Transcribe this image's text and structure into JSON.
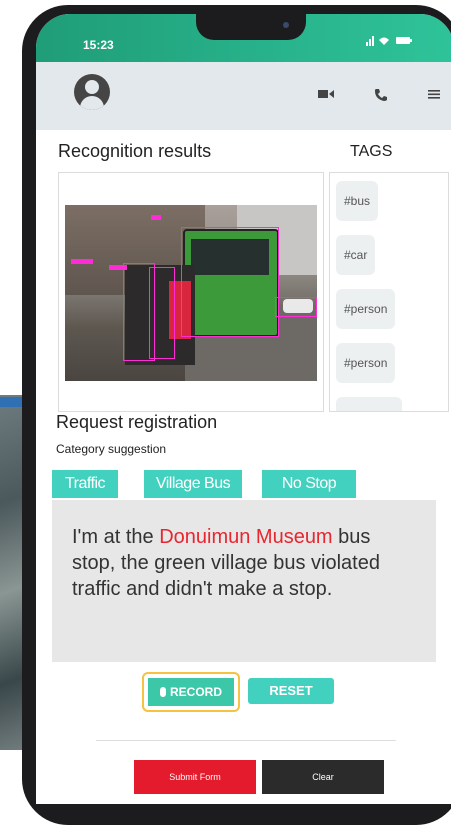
{
  "status_bar": {
    "time": "15:23",
    "icons": "signal, wifi, battery"
  },
  "app_bar": {
    "avatar": "user-avatar",
    "icons": [
      "video-icon",
      "phone-icon",
      "menu-icon"
    ]
  },
  "recognition": {
    "title": "Recognition results",
    "tags_title": "TAGS",
    "tags": [
      "#bus",
      "#car",
      "#person",
      "#person"
    ]
  },
  "request": {
    "title": "Request registration",
    "category_label": "Category suggestion",
    "categories": [
      "Traffic",
      "Village Bus",
      "No Stop"
    ],
    "message_prefix": "I'm at the ",
    "message_highlight": "Donuimun Museum",
    "message_suffix": " bus stop, the green village bus violated traffic and didn't make a stop."
  },
  "buttons": {
    "record": "RECORD",
    "reset": "RESET",
    "submit": "Submit Form",
    "clear": "Clear"
  },
  "colors": {
    "accent": "#43d1bf",
    "status_bar": "#2fc39a",
    "highlight": "#e8262f",
    "submit": "#e41b2c",
    "clear": "#2b2b2b"
  }
}
